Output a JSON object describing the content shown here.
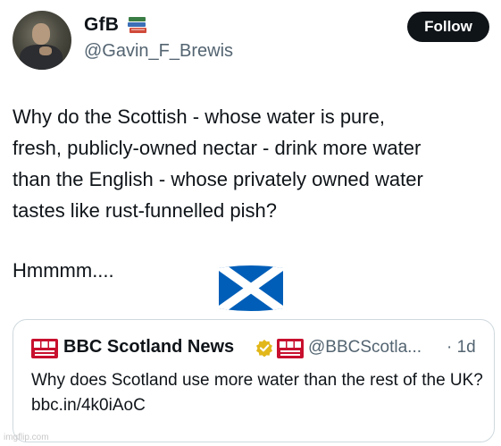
{
  "author": {
    "name": "GfB",
    "handle": "@Gavin_F_Brewis",
    "name_emoji_icon": "books-icon"
  },
  "follow_label": "Follow",
  "tweet": {
    "lines": [
      "Why do the Scottish - whose water is pure,",
      "fresh, publicly-owned nectar - drink more water",
      "than the English - whose privately owned water",
      "tastes like rust-funnelled pish?"
    ],
    "closing": "Hmmmm....",
    "emoji_icon": "scotland-flag-icon"
  },
  "quote": {
    "name": "BBC Scotland News",
    "handle": "@BBCScotla...",
    "time": "· 1d",
    "text": "Why does Scotland use more water than the rest of the UK? bbc.in/4k0iAoC",
    "verified_icon": "gold-verified-icon",
    "logo_icon": "bbc-news-scotland-logo",
    "logo_text": "BBC NEWS SCOTLAND"
  },
  "watermark": "imgflip.com",
  "colors": {
    "saltire_blue": "#005eb8",
    "follow_bg": "#0f1419",
    "bbc_red": "#c8102e",
    "secondary_text": "#536471"
  }
}
